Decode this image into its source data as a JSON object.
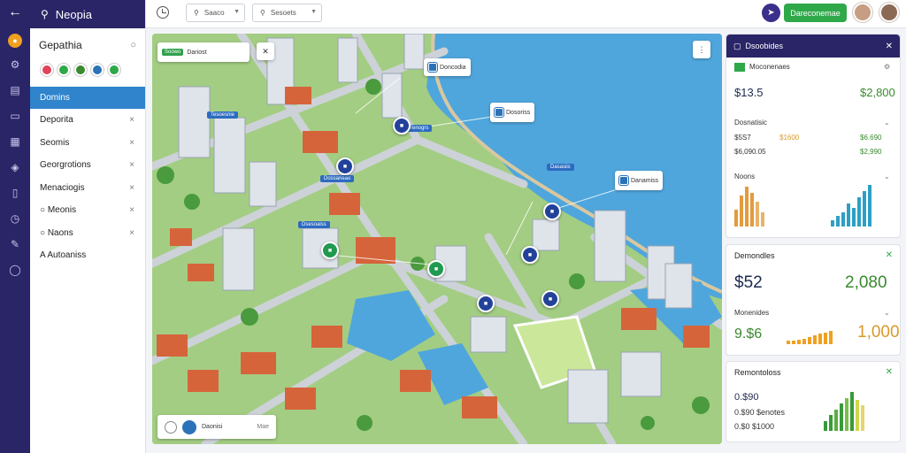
{
  "app": {
    "title": "Neopia"
  },
  "sidebar": {
    "title": "Gepathia",
    "active": "Domins",
    "items": [
      {
        "label": "Deporita",
        "mark": "×"
      },
      {
        "label": "Seomis",
        "mark": "×"
      },
      {
        "label": "Georgrotions",
        "mark": "×"
      },
      {
        "label": "Menaciogis",
        "mark": "×"
      },
      {
        "label": "Meonis",
        "mark": "×"
      },
      {
        "label": "Naons",
        "mark": "×"
      },
      {
        "label": "Autoaniss",
        "mark": ""
      }
    ],
    "chip_colors": [
      "#e0435a",
      "#2fa84a",
      "#3a8a2f",
      "#2b73b8",
      "#2fa84a"
    ]
  },
  "topbar": {
    "select1": "Saaco",
    "select2": "Sesoets",
    "dash_button": "Dareconemae"
  },
  "map": {
    "top_pill_badge": "Soowo",
    "top_pill_label": "Dariost",
    "bottom_label": "Daonisi",
    "bottom_sub": "Mae",
    "callouts": [
      {
        "label": "Doncodia"
      },
      {
        "label": "Dosoriss"
      },
      {
        "label": "Danamiss"
      }
    ],
    "tags": [
      "Tesoesnie",
      "Tenogrs",
      "Dossarieao",
      "Dasasiis",
      "Dsesoaiss"
    ]
  },
  "panels": {
    "main": {
      "title": "Dsoobides",
      "line1_label": "Moconenaes",
      "value_a": "$13.5",
      "value_b": "$2,800",
      "line2_label": "Dosnatisic",
      "line3_left": "$5S7",
      "line3_mid": "$1600",
      "line3_right": "$6.690",
      "line4_left": "$6,090.05",
      "line4_right": "$2,990",
      "chart_label": "Noons"
    },
    "sales": {
      "title": "Demondles",
      "value_a": "$52",
      "value_b": "2,080",
      "label": "Monenides",
      "value_c": "9.$6",
      "value_d": "1,000"
    },
    "remaining": {
      "title": "Remontoloss",
      "line1": "0.$90",
      "line2": "0.$90 $enotes",
      "line3": "0.$0 $1000"
    }
  }
}
